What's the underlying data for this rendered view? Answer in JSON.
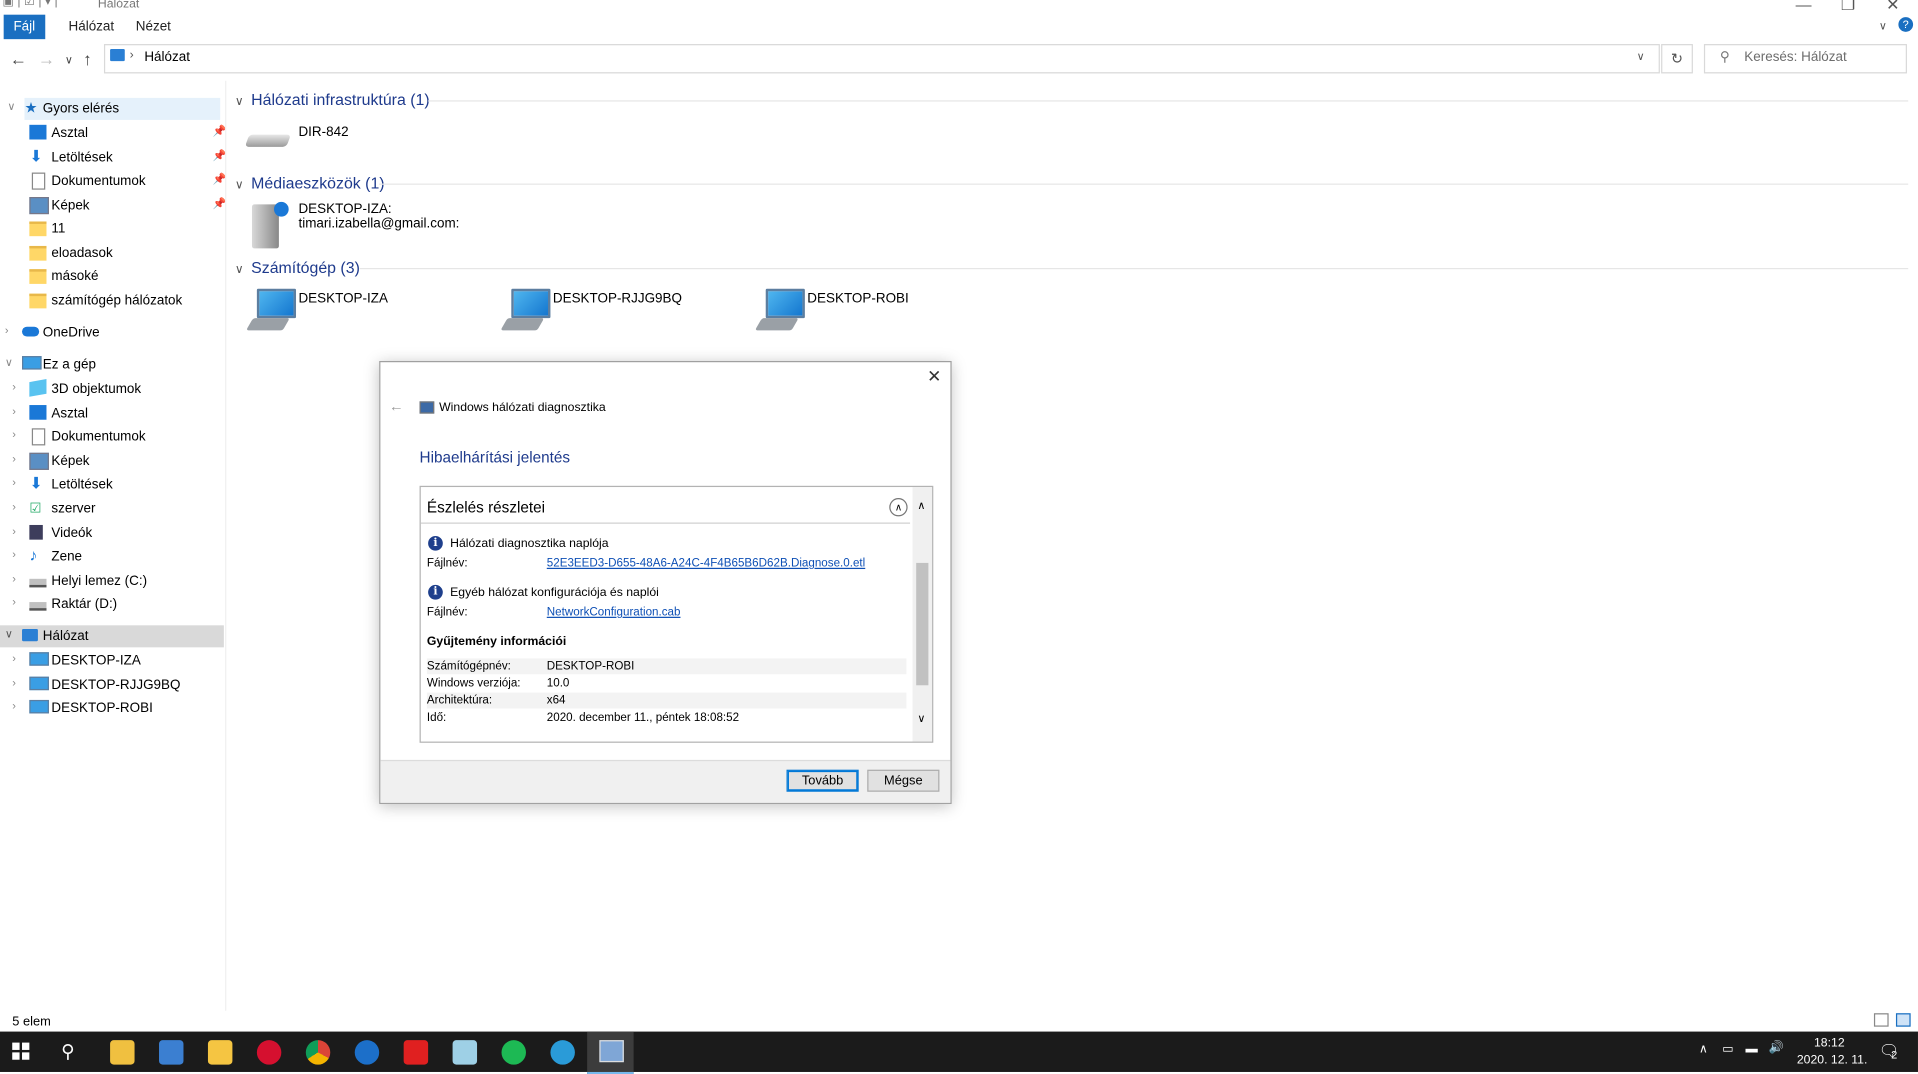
{
  "window": {
    "title": "Hálózat"
  },
  "ribbon": {
    "tabs": [
      "Fájl",
      "Hálózat",
      "Nézet"
    ]
  },
  "address": {
    "path": "Hálózat",
    "search_placeholder": "Keresés: Hálózat"
  },
  "sidebar": {
    "quick_access": "Gyors elérés",
    "quick_items": [
      "Asztal",
      "Letöltések",
      "Dokumentumok",
      "Képek",
      "11",
      "eloadasok",
      "másoké",
      "számítógép hálózatok"
    ],
    "onedrive": "OneDrive",
    "this_pc": "Ez a gép",
    "pc_items": [
      "3D objektumok",
      "Asztal",
      "Dokumentumok",
      "Képek",
      "Letöltések",
      "szerver",
      "Videók",
      "Zene",
      "Helyi lemez (C:)",
      "Raktár (D:)"
    ],
    "network": "Hálózat",
    "network_items": [
      "DESKTOP-IZA",
      "DESKTOP-RJJG9BQ",
      "DESKTOP-ROBI"
    ]
  },
  "groups": {
    "infra": {
      "title": "Hálózati infrastruktúra (1)",
      "device": "DIR-842"
    },
    "media": {
      "title": "Médiaeszközök (1)",
      "line1": "DESKTOP-IZA:",
      "line2": "timari.izabella@gmail.com:"
    },
    "computers": {
      "title": "Számítógép (3)",
      "items": [
        "DESKTOP-IZA",
        "DESKTOP-RJJG9BQ",
        "DESKTOP-ROBI"
      ]
    }
  },
  "dialog": {
    "title": "Windows hálózati diagnosztika",
    "heading": "Hibaelhárítási jelentés",
    "section": "Észlelés részletei",
    "log1_title": "Hálózati diagnosztika naplója",
    "log1_label": "Fájlnév:",
    "log1_file": "52E3EED3-D655-48A6-A24C-4F4B65B6D62B.Diagnose.0.etl",
    "log2_title": "Egyéb hálózat konfigurációja és naplói",
    "log2_label": "Fájlnév:",
    "log2_file": "NetworkConfiguration.cab",
    "info_title": "Gyűjtemény információi",
    "info": [
      {
        "k": "Számítógépnév:",
        "v": "DESKTOP-ROBI"
      },
      {
        "k": "Windows verziója:",
        "v": "10.0"
      },
      {
        "k": "Architektúra:",
        "v": "x64"
      },
      {
        "k": "Idő:",
        "v": "2020. december 11., péntek 18:08:52"
      }
    ],
    "next": "Tovább",
    "cancel": "Mégse"
  },
  "status": {
    "count": "5 elem"
  },
  "taskbar": {
    "time": "18:12",
    "date": "2020. 12. 11.",
    "notif_count": "2"
  }
}
